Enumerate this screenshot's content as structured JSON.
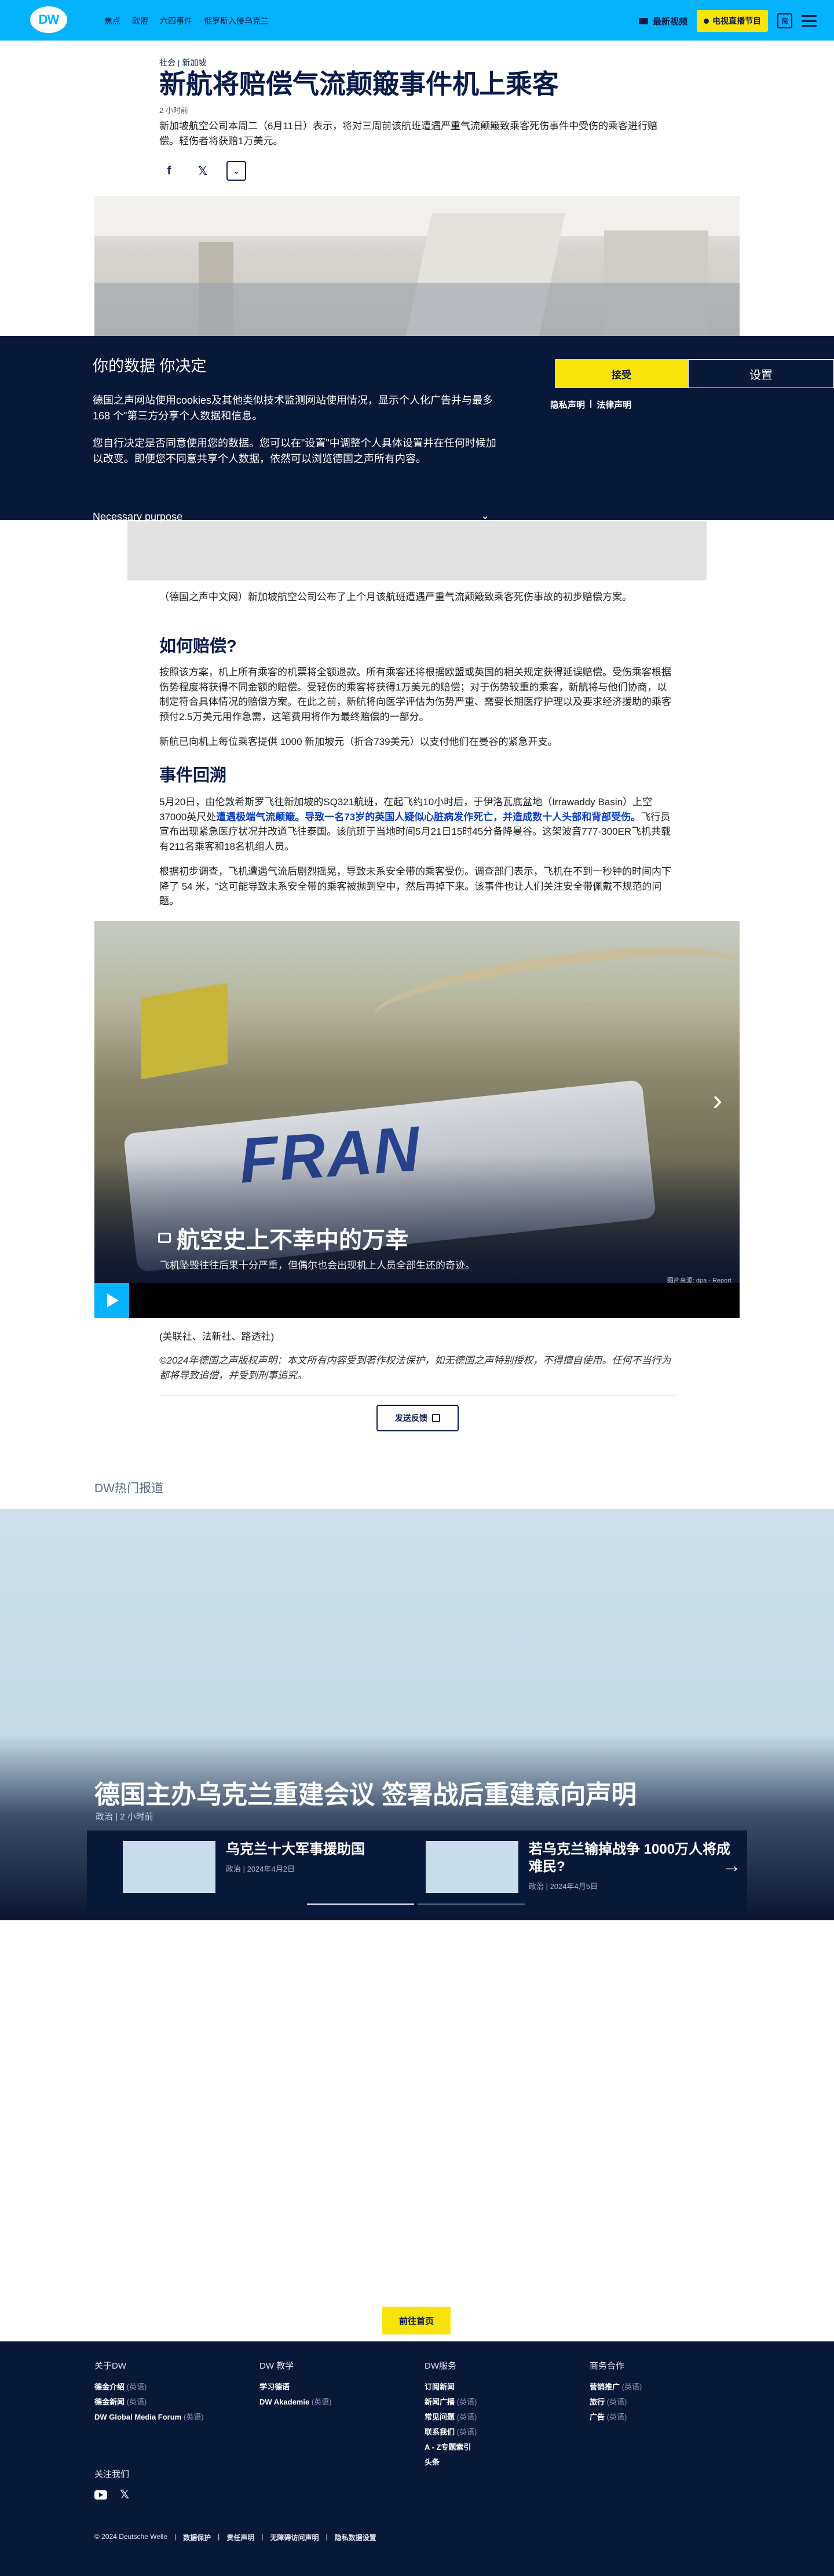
{
  "header": {
    "logo": "DW",
    "nav": [
      "焦点",
      "欧盟",
      "六四事件",
      "俄罗斯入侵乌克兰"
    ],
    "live_label": "最新视频",
    "tv_label": "电视直播节目",
    "lang_label": "简"
  },
  "article": {
    "breadcrumb": "社会 | 新加坡",
    "title": "新航将赔偿气流颠簸事件机上乘客",
    "time_ago": "2 小时前",
    "lead": "新加坡航空公司本周二（6月11日）表示，将对三周前该航班遭遇严重气流颠簸致乘客死伤事件中受伤的乘客进行赔偿。轻伤者将获赔1万美元。",
    "intro": "（德国之声中文网）新加坡航空公司公布了上个月该航班遭遇严重气流颠簸致乘客死伤事故的初步赔偿方案。",
    "h_compensation": "如何赔偿?",
    "p1": "按照该方案，机上所有乘客的机票将全额退款。所有乘客还将根据欧盟或英国的相关规定获得延误赔偿。受伤乘客根据伤势程度将获得不同金额的赔偿。受轻伤的乘客将获得1万美元的赔偿；对于伤势较重的乘客，新航将与他们协商，以制定符合具体情况的赔偿方案。在此之前，新航将向医学评估为伤势严重、需要长期医疗护理以及要求经济援助的乘客预付2.5万美元用作急需，这笔费用将作为最终赔偿的一部分。",
    "p2": "新航已向机上每位乘客提供 1000 新加坡元（折合739美元）以支付他们在曼谷的紧急开支。",
    "h_review": "事件回溯",
    "p3_a": "5月20日，由伦敦希斯罗飞往新加坡的SQ321航班，在起飞约10小时后，于伊洛瓦底盆地（Irrawaddy Basin）上空37000英尺处",
    "p3_strong": "遭遇极端气流颠簸。导致一名73岁的英国人疑似心脏病发作死亡，并造成数十人头部和背部受伤。",
    "p3_b": "飞行员宣布出现紧急医疗状况并改道飞往泰国。该航班于当地时间5月21日15时45分备降曼谷。这架波音777-300ER飞机共载有211名乘客和18名机组人员。",
    "p4": "根据初步调查，飞机遭遇气流后剧烈摇晃，导致未系安全带的乘客受伤。调查部门表示，飞机在不到一秒钟的时间内下降了 54 米，\"这可能导致未系安全带的乘客被抛到空中，然后再掉下来。该事件也让人们关注安全带佩戴不规范的问题。",
    "source": "(美联社、法新社、路透社)",
    "copyright": "©2024年德国之声版权声明：本文所有内容受到著作权法保护，如无德国之声特别授权，不得擅自使用。任何不当行为都将导致追偿，并受到刑事追究。",
    "feedback_label": "发送反馈"
  },
  "gallery": {
    "title": "航空史上不幸中的万幸",
    "subtitle": "飞机坠毁往往后果十分严重，但偶尔也会出现机上人员全部生还的奇迹。",
    "credit": "图片来源: dpa - Report",
    "image_text": "FRAN"
  },
  "cookie": {
    "title": "你的数据 你决定",
    "p1": "德国之声网站使用cookies及其他类似技术监测网站使用情况，显示个人化广告并与最多168 个\"第三方分享个人数据和信息。",
    "p2": "您自行决定是否同意使用您的数据。您可以在\"设置\"中调整个人具体设置并在任何时候加以改变。即便您不同意共享个人数据，依然可以浏览德国之声所有内容。",
    "necessary": "Necessary purpose",
    "accept": "接受",
    "settings": "设置",
    "privacy": "隐私声明",
    "legal": "法律声明",
    "sep": "|"
  },
  "hot": {
    "label": "DW热门报道",
    "main_title": "德国主办乌克兰重建会议 签署战后重建意向声明",
    "main_meta": "政治 | 2 小时前",
    "items": [
      {
        "title": "乌克兰十大军事援助国",
        "meta": "政治 | 2024年4月2日"
      },
      {
        "title": "若乌克兰输掉战争 1000万人将成难民?",
        "meta": "政治 | 2024年4月5日"
      }
    ]
  },
  "front_button": "前往首页",
  "footer": {
    "col1": {
      "heading": "关于DW",
      "links": [
        [
          "德金介绍",
          "(英语)"
        ],
        [
          "德金新闻",
          "(英语)"
        ],
        [
          "DW Global Media Forum",
          "(英语)"
        ]
      ]
    },
    "col2": {
      "heading": "DW 教学",
      "links": [
        [
          "学习德语",
          ""
        ],
        [
          "DW Akademie",
          "(英语)"
        ]
      ]
    },
    "col3": {
      "heading": "DW服务",
      "links": [
        [
          "订阅新闻",
          ""
        ],
        [
          "新闻广播",
          "(英语)"
        ],
        [
          "常见问题",
          "(英语)"
        ],
        [
          "联系我们",
          "(英语)"
        ],
        [
          "A - Z专题索引",
          ""
        ],
        [
          "头条",
          ""
        ]
      ]
    },
    "col4": {
      "heading": "商务合作",
      "links": [
        [
          "营销推广",
          "(英语)"
        ],
        [
          "旅行",
          "(英语)"
        ],
        [
          "广告",
          "(英语)"
        ]
      ]
    },
    "follow": "关注我们",
    "bottom": {
      "copyright": "© 2024 Deutsche Welle",
      "l1": "数据保护",
      "l2": "责任声明",
      "l3": "无障碍访问声明",
      "l4": "隐私数据设置",
      "sep": "|"
    }
  },
  "colors": {
    "accent": "#05b2fc",
    "navy": "#081838",
    "yellow": "#f8e40a"
  }
}
